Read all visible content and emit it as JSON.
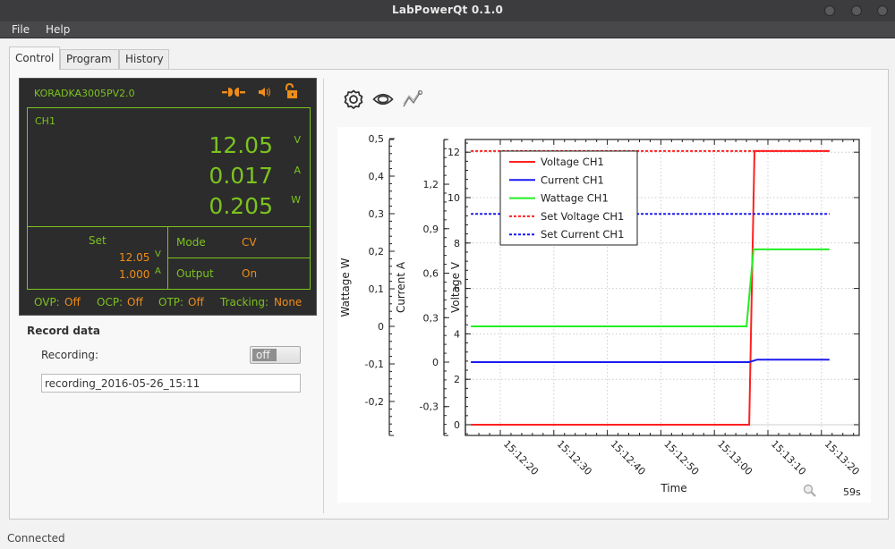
{
  "window": {
    "title": "LabPowerQt 0.1.0",
    "controls": [
      "minimize",
      "maximize",
      "close"
    ]
  },
  "menu": [
    {
      "label": "File"
    },
    {
      "label": "Help"
    }
  ],
  "tabs": [
    {
      "label": "Control",
      "active": true
    },
    {
      "label": "Program",
      "active": false
    },
    {
      "label": "History",
      "active": false
    }
  ],
  "device": {
    "name": "KORADKA3005PV2.0",
    "icons": [
      "connection-plug-icon",
      "speaker-sound-icon",
      "unlocked-padlock-icon"
    ],
    "channel": "CH1",
    "readings": {
      "voltage": {
        "value": "12.05",
        "unit": "V"
      },
      "current": {
        "value": "0.017",
        "unit": "A"
      },
      "wattage": {
        "value": "0.205",
        "unit": "W"
      }
    },
    "set": {
      "label": "Set",
      "voltage": {
        "value": "12.05",
        "unit": "V"
      },
      "current": {
        "value": "1.000",
        "unit": "A"
      }
    },
    "mode": {
      "label": "Mode",
      "value": "CV"
    },
    "output": {
      "label": "Output",
      "value": "On"
    },
    "protections": {
      "ovp": {
        "label": "OVP:",
        "value": "Off"
      },
      "ocp": {
        "label": "OCP:",
        "value": "Off"
      },
      "otp": {
        "label": "OTP:",
        "value": "Off"
      },
      "tracking": {
        "label": "Tracking:",
        "value": "None"
      }
    },
    "colors": {
      "label_green": "#7cc31f",
      "value_orange": "#ef8d1a",
      "background": "#2c2c2c"
    }
  },
  "record": {
    "title": "Record data",
    "recording_label": "Recording:",
    "toggle_value": "off",
    "filename": "recording_2016-05-26_15:11"
  },
  "chart_toolbar": {
    "icons": [
      "settings-gear-icon",
      "visibility-eye-icon",
      "graph-line-icon"
    ]
  },
  "chart_footer": {
    "zoom_icon": "magnifier-icon",
    "duration": "59s"
  },
  "status": {
    "text": "Connected"
  },
  "chart_data": {
    "type": "line",
    "title": "",
    "xlabel": "Time",
    "x_ticks": [
      "15:12:20",
      "15:12:30",
      "15:12:40",
      "15:12:50",
      "15:13:00",
      "15:13:10",
      "15:13:20"
    ],
    "x_range_seconds": [
      0,
      68
    ],
    "x_start_time": "15:12:13.5",
    "axes": [
      {
        "id": "wattage",
        "label": "Wattage W",
        "ticks": [
          "0,5",
          "0,4",
          "0,3",
          "0,2",
          "0,1",
          "0",
          "-0,1",
          "-0,2"
        ],
        "tick_values": [
          0.5,
          0.4,
          0.3,
          0.2,
          0.1,
          0,
          -0.1,
          -0.2
        ],
        "range": [
          -0.29,
          0.5
        ]
      },
      {
        "id": "current",
        "label": "Current A",
        "ticks": [
          "1,2",
          "0,9",
          "0,6",
          "0,3",
          "0",
          "-0,3"
        ],
        "tick_values": [
          1.2,
          0.9,
          0.6,
          0.3,
          0,
          -0.3
        ],
        "range": [
          -0.5,
          1.5
        ]
      },
      {
        "id": "voltage",
        "label": "Voltage V",
        "ticks": [
          "12",
          "10",
          "8",
          "6",
          "4",
          "2",
          "0"
        ],
        "tick_values": [
          12,
          10,
          8,
          6,
          4,
          2,
          0
        ],
        "range": [
          -0.5,
          12.5
        ]
      }
    ],
    "grid": true,
    "legend_position": "top-left",
    "series": [
      {
        "name": "Voltage CH1",
        "axis": "voltage",
        "color": "#ff2020",
        "style": "solid",
        "points": [
          [
            1,
            0
          ],
          [
            53,
            0
          ],
          [
            54,
            12.05
          ],
          [
            68,
            12.05
          ]
        ]
      },
      {
        "name": "Current CH1",
        "axis": "current",
        "color": "#1a1aee",
        "style": "solid",
        "points": [
          [
            1,
            0.0
          ],
          [
            53,
            0.0
          ],
          [
            54.5,
            0.017
          ],
          [
            68,
            0.017
          ]
        ]
      },
      {
        "name": "Wattage CH1",
        "axis": "wattage",
        "color": "#22ee22",
        "style": "solid",
        "points": [
          [
            1,
            0.0
          ],
          [
            52.5,
            0.0
          ],
          [
            53.8,
            0.205
          ],
          [
            68,
            0.205
          ]
        ]
      },
      {
        "name": "Set Voltage CH1",
        "axis": "voltage",
        "color": "#ff2020",
        "style": "dashed",
        "points": [
          [
            1,
            12.05
          ],
          [
            68,
            12.05
          ]
        ]
      },
      {
        "name": "Set Current CH1",
        "axis": "current",
        "color": "#1a1aee",
        "style": "dashed",
        "points": [
          [
            1,
            1.0
          ],
          [
            68,
            1.0
          ]
        ]
      }
    ]
  }
}
